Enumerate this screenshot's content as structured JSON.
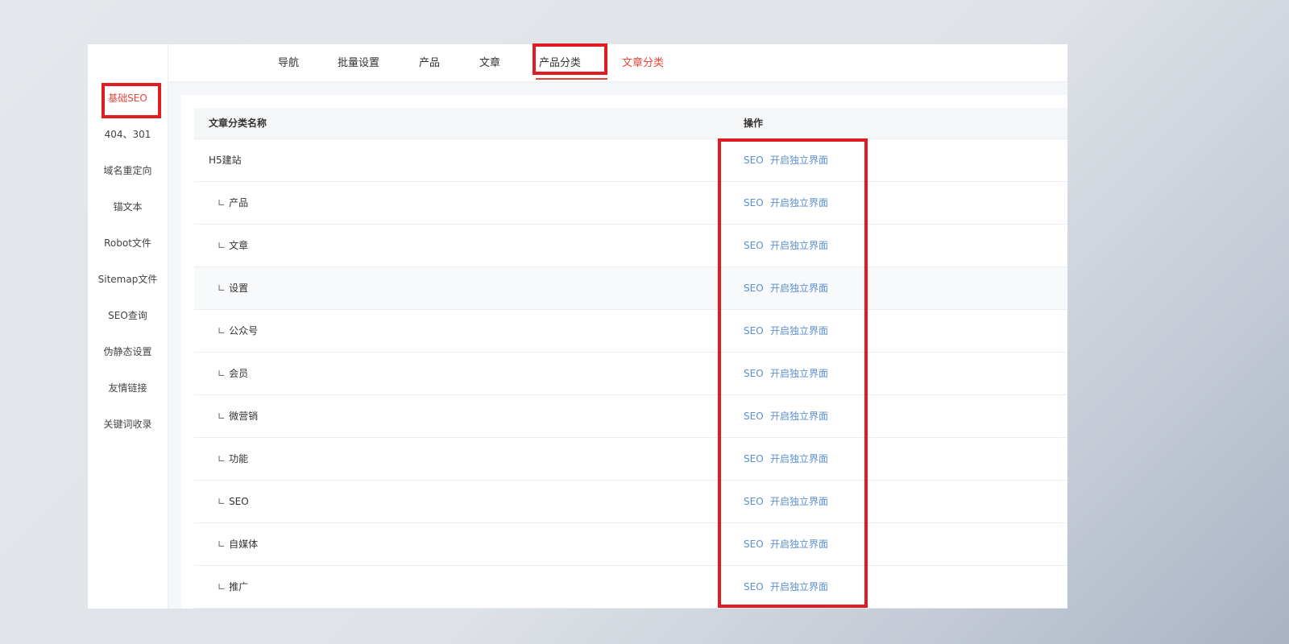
{
  "sidebar": {
    "items": [
      {
        "label": "基础SEO",
        "active": true
      },
      {
        "label": "404、301"
      },
      {
        "label": "域名重定向"
      },
      {
        "label": "锚文本"
      },
      {
        "label": "Robot文件"
      },
      {
        "label": "Sitemap文件"
      },
      {
        "label": "SEO查询"
      },
      {
        "label": "伪静态设置"
      },
      {
        "label": "友情链接"
      },
      {
        "label": "关键词收录"
      }
    ]
  },
  "tabs": [
    {
      "label": "导航"
    },
    {
      "label": "批量设置"
    },
    {
      "label": "产品"
    },
    {
      "label": "文章"
    },
    {
      "label": "产品分类"
    },
    {
      "label": "文章分类",
      "active": true
    }
  ],
  "table": {
    "columns": [
      "文章分类名称",
      "操作"
    ],
    "child_prefix": "∟",
    "rows": [
      {
        "name": "H5建站",
        "child": false
      },
      {
        "name": "产品",
        "child": true
      },
      {
        "name": "文章",
        "child": true
      },
      {
        "name": "设置",
        "child": true
      },
      {
        "name": "公众号",
        "child": true
      },
      {
        "name": "会员",
        "child": true
      },
      {
        "name": "微营销",
        "child": true
      },
      {
        "name": "功能",
        "child": true
      },
      {
        "name": "SEO",
        "child": true
      },
      {
        "name": "自媒体",
        "child": true
      },
      {
        "name": "推广",
        "child": true
      }
    ],
    "actions": {
      "seo": "SEO",
      "open": "开启独立界面"
    }
  },
  "colors": {
    "accent": "#e8443a",
    "highlight_box": "#e01b22",
    "link": "#5b8fd0"
  }
}
